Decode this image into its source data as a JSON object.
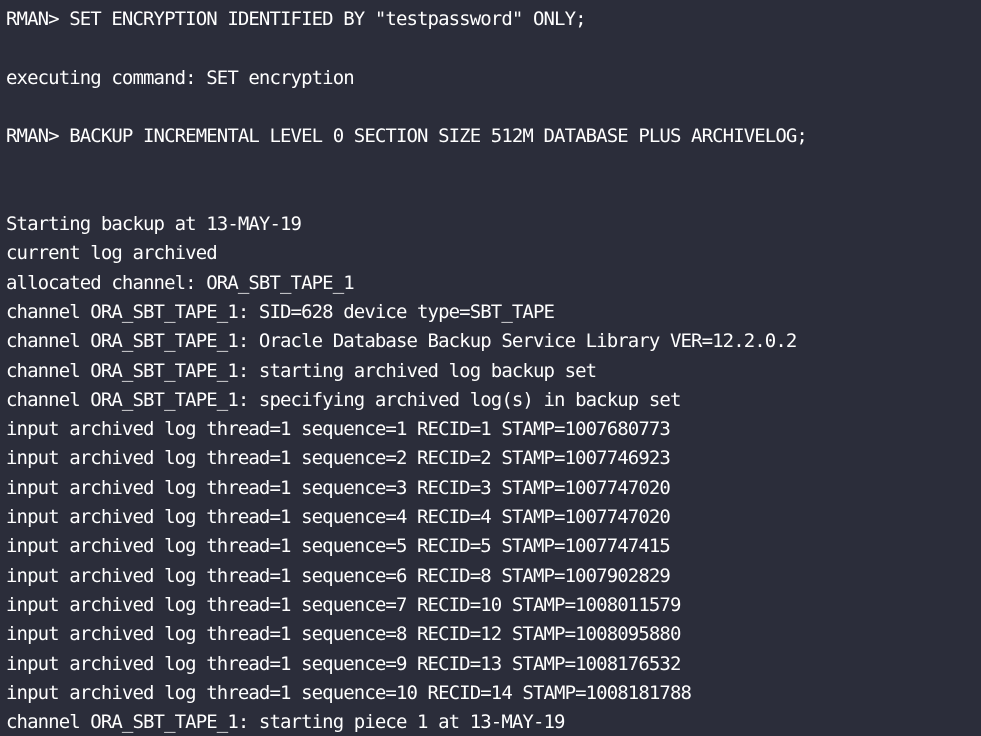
{
  "terminal": {
    "lines": [
      "RMAN> SET ENCRYPTION IDENTIFIED BY \"testpassword\" ONLY;",
      "",
      "executing command: SET encryption",
      "",
      "RMAN> BACKUP INCREMENTAL LEVEL 0 SECTION SIZE 512M DATABASE PLUS ARCHIVELOG;",
      "",
      "",
      "Starting backup at 13-MAY-19",
      "current log archived",
      "allocated channel: ORA_SBT_TAPE_1",
      "channel ORA_SBT_TAPE_1: SID=628 device type=SBT_TAPE",
      "channel ORA_SBT_TAPE_1: Oracle Database Backup Service Library VER=12.2.0.2",
      "channel ORA_SBT_TAPE_1: starting archived log backup set",
      "channel ORA_SBT_TAPE_1: specifying archived log(s) in backup set",
      "input archived log thread=1 sequence=1 RECID=1 STAMP=1007680773",
      "input archived log thread=1 sequence=2 RECID=2 STAMP=1007746923",
      "input archived log thread=1 sequence=3 RECID=3 STAMP=1007747020",
      "input archived log thread=1 sequence=4 RECID=4 STAMP=1007747020",
      "input archived log thread=1 sequence=5 RECID=5 STAMP=1007747415",
      "input archived log thread=1 sequence=6 RECID=8 STAMP=1007902829",
      "input archived log thread=1 sequence=7 RECID=10 STAMP=1008011579",
      "input archived log thread=1 sequence=8 RECID=12 STAMP=1008095880",
      "input archived log thread=1 sequence=9 RECID=13 STAMP=1008176532",
      "input archived log thread=1 sequence=10 RECID=14 STAMP=1008181788",
      "channel ORA_SBT_TAPE_1: starting piece 1 at 13-MAY-19"
    ]
  },
  "colors": {
    "background": "#2b2d3a",
    "text": "#ffffff"
  }
}
